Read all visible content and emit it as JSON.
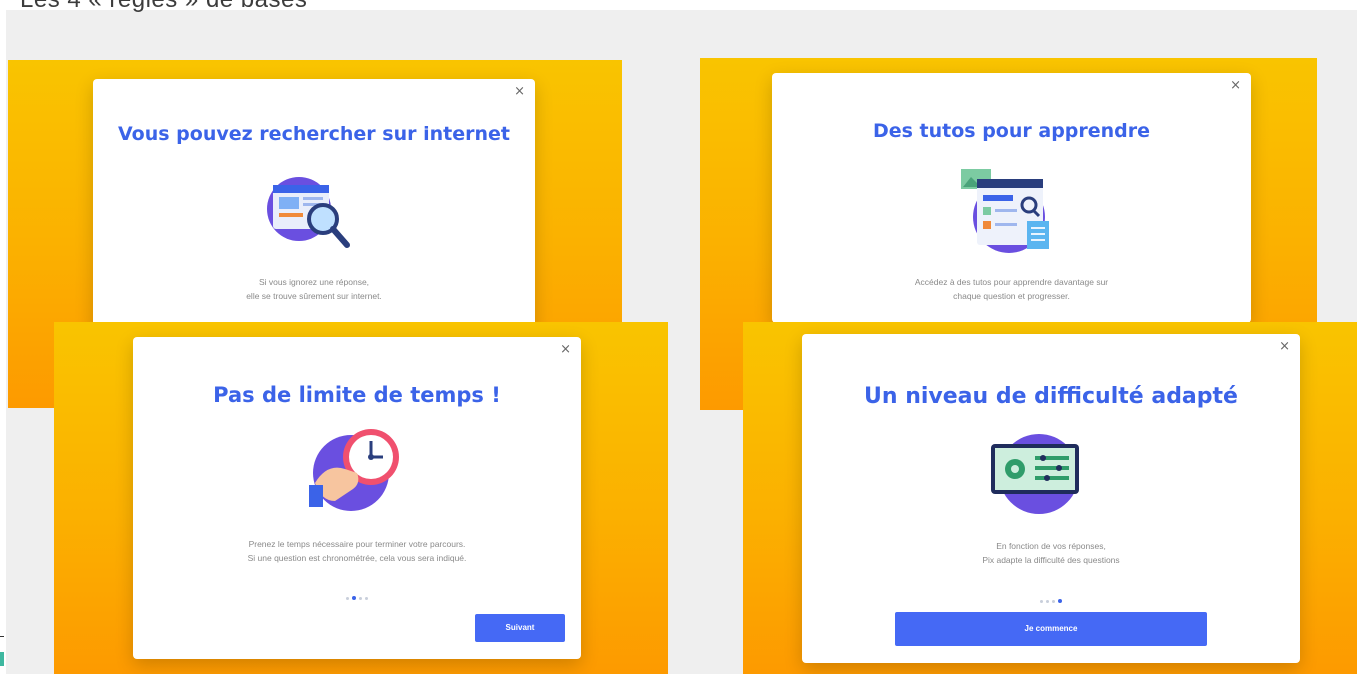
{
  "page": {
    "title": "Les 4 « règles » de bases"
  },
  "cards": [
    {
      "title": "Vous pouvez rechercher sur internet",
      "text_lines": [
        "Si vous ignorez une réponse,",
        "elle se trouve sûrement sur internet."
      ],
      "close": "×",
      "icon": "magnifier-icon"
    },
    {
      "title": "Des tutos pour apprendre",
      "text_lines": [
        "Accédez à des tutos pour apprendre davantage sur",
        "chaque question et progresser."
      ],
      "close": "×",
      "icon": "tutorial-page-icon"
    },
    {
      "title": "Pas de limite de temps !",
      "text_lines": [
        "Prenez le temps nécessaire pour terminer votre parcours.",
        "Si une question est chronométrée, cela vous sera indiqué."
      ],
      "close": "×",
      "icon": "clock-icon",
      "pagination": {
        "total": 4,
        "active": 1
      },
      "button": "Suivant"
    },
    {
      "title": "Un niveau de difficulté adapté",
      "text_lines": [
        "En fonction de vos réponses,",
        "Pix adapte la difficulté des questions"
      ],
      "close": "×",
      "icon": "settings-screen-icon",
      "pagination": {
        "total": 4,
        "active": 3
      },
      "button": "Je commence"
    }
  ],
  "colors": {
    "accent_blue": "#3b63e8",
    "button_blue": "#4569f5",
    "panel_yellow": "#f9c400",
    "panel_orange": "#fd9a00"
  }
}
